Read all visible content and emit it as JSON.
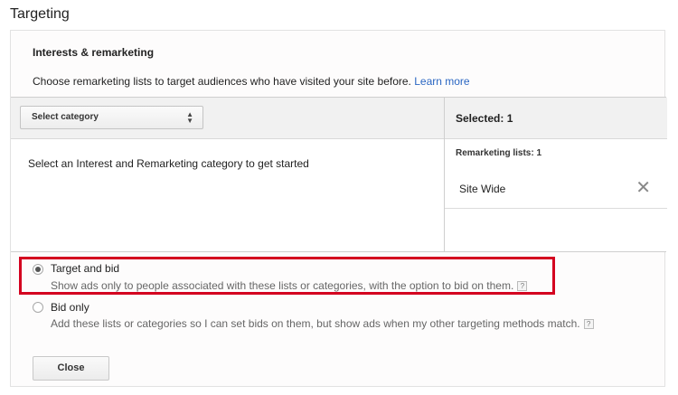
{
  "page": {
    "title": "Targeting"
  },
  "section": {
    "heading": "Interests & remarketing",
    "description": "Choose remarketing lists to target audiences who have visited your site before.",
    "learn_more": "Learn more"
  },
  "category_picker": {
    "label": "Select category",
    "empty_message": "Select an Interest and Remarketing category to get started"
  },
  "selection": {
    "header": "Selected: 1",
    "group_label": "Remarketing lists: 1",
    "items": [
      {
        "name": "Site Wide"
      }
    ]
  },
  "options": [
    {
      "title": "Target and bid",
      "description": "Show ads only to people associated with these lists or categories, with the option to bid on them.",
      "help": "?",
      "selected": true
    },
    {
      "title": "Bid only",
      "description": "Add these lists or categories so I can set bids on them, but show ads when my other targeting methods match.",
      "help": "?",
      "selected": false
    }
  ],
  "footer": {
    "close_label": "Close"
  },
  "colors": {
    "link": "#2a66c2",
    "highlight": "#d4001f"
  }
}
